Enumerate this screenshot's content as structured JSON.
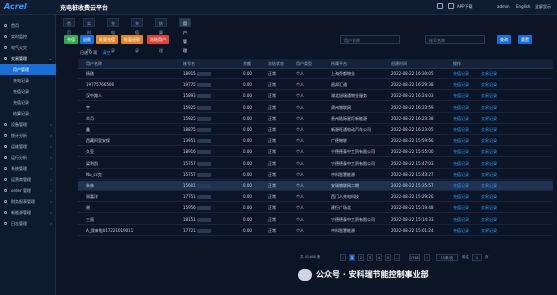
{
  "app": {
    "logo": "Acrel",
    "title": "充电桩收费云平台",
    "top_right": {
      "tasks": "APP下载",
      "user": "admin",
      "lang": "English",
      "fullscreen": "全屏显示"
    }
  },
  "sidebar": {
    "items": [
      {
        "label": "首页",
        "icon": "home-icon"
      },
      {
        "label": "实时监控",
        "icon": "monitor-icon"
      },
      {
        "label": "电气火灾",
        "icon": "fire-icon"
      },
      {
        "label": "交易管理",
        "icon": "trade-icon",
        "expanded": true
      },
      {
        "label": "用户管理",
        "active": true
      },
      {
        "label": "充电记录"
      },
      {
        "label": "充值记录"
      },
      {
        "label": "充值记录"
      },
      {
        "label": "结算记录"
      },
      {
        "label": "设备管理",
        "icon": "device-icon"
      },
      {
        "label": "统计分析",
        "icon": "chart-icon"
      },
      {
        "label": "运维管理",
        "icon": "tools-icon"
      },
      {
        "label": "运行分析",
        "icon": "analysis-icon"
      },
      {
        "label": "系统管理",
        "icon": "settings-icon"
      },
      {
        "label": "运营商管理",
        "icon": "operator-icon"
      },
      {
        "label": "order 管理",
        "icon": "order-icon"
      },
      {
        "label": "财务报表管理",
        "icon": "finance-icon"
      },
      {
        "label": "新能源管理",
        "icon": "energy-icon"
      },
      {
        "label": "日志管理",
        "icon": "log-icon"
      }
    ]
  },
  "tabs": [
    "首页",
    "实时监控",
    "充电记录",
    "充值记录",
    "结算管理",
    "用户管理"
  ],
  "toolbar": {
    "buttons": [
      {
        "label": "充值",
        "color": "#2fa84f"
      },
      {
        "label": "退款",
        "color": "#1a6fd6"
      },
      {
        "label": "批量充值",
        "color": "#e0852a"
      },
      {
        "label": "批量退款",
        "color": "#e0852a"
      },
      {
        "label": "冻结用户",
        "color": "#d9453a"
      }
    ],
    "search_placeholder_1": "用户名称",
    "search_placeholder_2": "账号名称",
    "query_label": "查询",
    "reset_label": "重置"
  },
  "selection": {
    "text": "已选 0 项",
    "clear": "清空"
  },
  "table": {
    "columns": [
      "用户名称",
      "账号名",
      "余额",
      "冻结状态",
      "用户类型",
      "所属平台",
      "创建时间",
      "操作"
    ],
    "rows": [
      {
        "name": "杨刚",
        "account": "18915",
        "balance": "0.00",
        "status": "正常",
        "type": "个人",
        "platform": "上海乔都物业",
        "time": "2022-08-22 16:30:05",
        "hl": false
      },
      {
        "name": "19775766506",
        "account": "19775",
        "balance": "0.00",
        "status": "正常",
        "type": "个人",
        "platform": "昌邦汇通",
        "time": "2022-08-22 16:29:38",
        "hl": false
      },
      {
        "name": "汉中路人",
        "account": "15893",
        "balance": "0.00",
        "status": "正常",
        "type": "个人",
        "platform": "湖北旭瑞通物业服务",
        "time": "2022-08-22 16:24:03",
        "hl": false
      },
      {
        "name": "宇",
        "account": "15925",
        "balance": "0.00",
        "status": "正常",
        "type": "个人",
        "platform": "肃州物联网",
        "time": "2022-08-22 16:23:59",
        "hl": false
      },
      {
        "name": "炎月",
        "account": "15925",
        "balance": "0.00",
        "status": "正常",
        "type": "个人",
        "platform": "贵州陆际星灯新能源",
        "time": "2022-08-22 16:23:38",
        "hl": false
      },
      {
        "name": "鑫",
        "account": "18875",
        "balance": "0.00",
        "status": "正常",
        "type": "个人",
        "platform": "新源旺通电动汽车公司",
        "time": "2022-08-22 16:23:05",
        "hl": false
      },
      {
        "name": "西藏阿里安保",
        "account": "13951",
        "balance": "0.00",
        "status": "正常",
        "type": "个人",
        "platform": "广德物联",
        "time": "2022-08-22 15:59:56",
        "hl": false
      },
      {
        "name": "久亚",
        "account": "18916",
        "balance": "0.00",
        "status": "正常",
        "type": "个人",
        "platform": "宁德德泰中工贸有限公司",
        "time": "2022-08-22 15:55:00",
        "hl": false
      },
      {
        "name": "梁利凯",
        "account": "15757",
        "balance": "0.00",
        "status": "正常",
        "type": "个人",
        "platform": "宁德德泰中工贸有限公司",
        "time": "2022-08-22 15:47:03",
        "hl": false
      },
      {
        "name": "Nu_cc克",
        "account": "15757",
        "balance": "0.00",
        "status": "正常",
        "type": "个人",
        "platform": "中科智慧能源",
        "time": "2022-08-22 15:43:27",
        "hl": false
      },
      {
        "name": "朱林",
        "account": "15601",
        "balance": "0.00",
        "status": "正常",
        "type": "个人",
        "platform": "安瑞物联网二期",
        "time": "2022-08-22 15:35:57",
        "hl": true
      },
      {
        "name": "周嘉洋",
        "account": "17751",
        "balance": "0.00",
        "status": "正常",
        "type": "个人",
        "platform": "西门人充电科技",
        "time": "2022-08-22 15:29:26",
        "hl": false
      },
      {
        "name": "谢",
        "account": "15956",
        "balance": "0.00",
        "status": "正常",
        "type": "个人",
        "platform": "建行广场北",
        "time": "2022-08-22 15:19:48",
        "hl": false
      },
      {
        "name": "三丽",
        "account": "18151",
        "balance": "0.00",
        "status": "正常",
        "type": "个人",
        "platform": "宁德德泰中工贸有限公司",
        "time": "2022-08-22 15:14:33",
        "hl": false
      },
      {
        "name": "A_我来啦017221019011",
        "account": "17721",
        "balance": "0.00",
        "status": "正常",
        "type": "个人",
        "platform": "中科智慧能源",
        "time": "2022-08-22 15:01:24",
        "hl": false
      }
    ],
    "action_1": "充值记录",
    "action_2": "交易记录"
  },
  "pager": {
    "total": "共 41468 条",
    "pages": [
      "1",
      "2",
      "3",
      "4",
      "5",
      "...",
      "2765"
    ],
    "size": "15条/页",
    "goto": "前往",
    "page": "1",
    "page_unit": "页"
  },
  "watermark": {
    "text": "公众号 · 安科瑞节能控制事业部"
  }
}
